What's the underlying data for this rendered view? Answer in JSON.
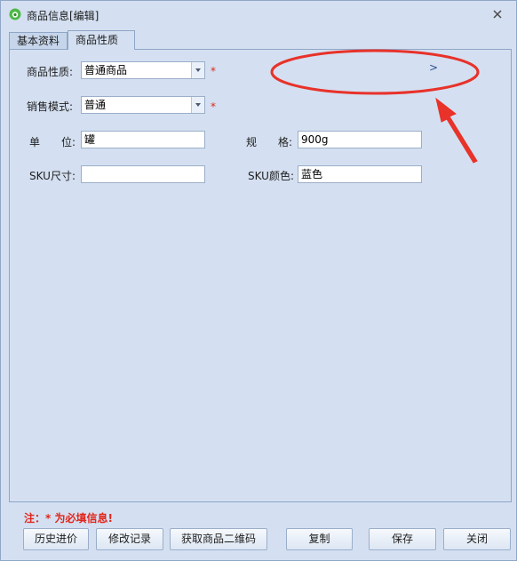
{
  "window": {
    "title": "商品信息[编辑]"
  },
  "tabs": [
    {
      "label": "基本资料"
    },
    {
      "label": "商品性质"
    }
  ],
  "form": {
    "product_nature": {
      "label": "商品性质:",
      "value": "普通商品"
    },
    "sales_mode": {
      "label": "销售模式:",
      "value": "普通"
    },
    "unit": {
      "label": "单　　位:",
      "value": "罐"
    },
    "spec": {
      "label": "规　　格:",
      "value": "900g"
    },
    "sku_size": {
      "label": "SKU尺寸:",
      "value": ""
    },
    "sku_color": {
      "label": "SKU颜色:",
      "value": "蓝色"
    },
    "required_mark": "*",
    "expand_marker": ">"
  },
  "footer": {
    "note": "注：* 为必填信息!",
    "buttons": {
      "history": "历史进价",
      "modify_log": "修改记录",
      "qrcode": "获取商品二维码",
      "copy": "复制",
      "save": "保存",
      "close": "关闭"
    }
  },
  "colors": {
    "annotation": "#e8322a",
    "required": "#e2261c",
    "window_bg": "#d4e0f1"
  }
}
